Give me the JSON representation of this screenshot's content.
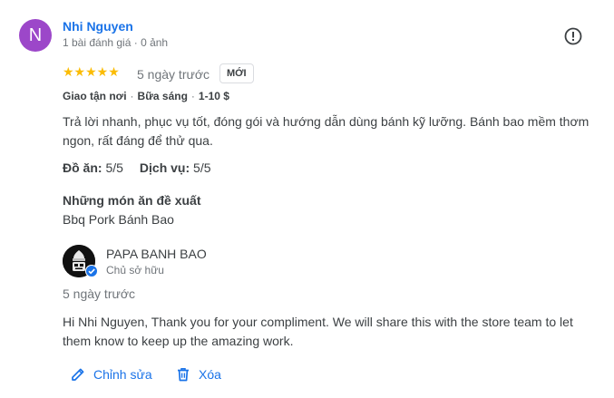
{
  "reviewer": {
    "initial": "N",
    "name": "Nhi Nguyen",
    "meta": "1 bài đánh giá · 0 ảnh"
  },
  "review": {
    "stars": "★★★★★",
    "rating": 5,
    "time_ago": "5 ngày trước",
    "new_badge": "MỚI",
    "tags": [
      "Giao tận nơi",
      "Bữa sáng",
      "1-10 $"
    ],
    "text": "Trả lời nhanh, phục vụ tốt, đóng gói và hướng dẫn dùng bánh kỹ lưỡng. Bánh bao mềm thơm ngon, rất đáng để thử qua.",
    "food_label": "Đồ ăn:",
    "food_score": "5/5",
    "service_label": "Dịch vụ:",
    "service_score": "5/5",
    "recommended_heading": "Những món ăn đề xuất",
    "recommended_dish": "Bbq Pork Bánh Bao"
  },
  "owner_response": {
    "name": "PAPA BANH BAO",
    "role": "Chủ sở hữu",
    "time_ago": "5 ngày trước",
    "text": "Hi Nhi Nguyen, Thank you for your compliment. We will share this with the store team to let them know to keep up the amazing work."
  },
  "actions": {
    "edit_label": "Chỉnh sửa",
    "delete_label": "Xóa"
  },
  "colors": {
    "avatar": "#9c47c9",
    "link": "#1a73e8",
    "star": "#fbbc04",
    "verified": "#1a73e8"
  },
  "icons": [
    "alert-circle-icon",
    "verified-badge-icon",
    "pencil-icon",
    "trash-icon"
  ]
}
